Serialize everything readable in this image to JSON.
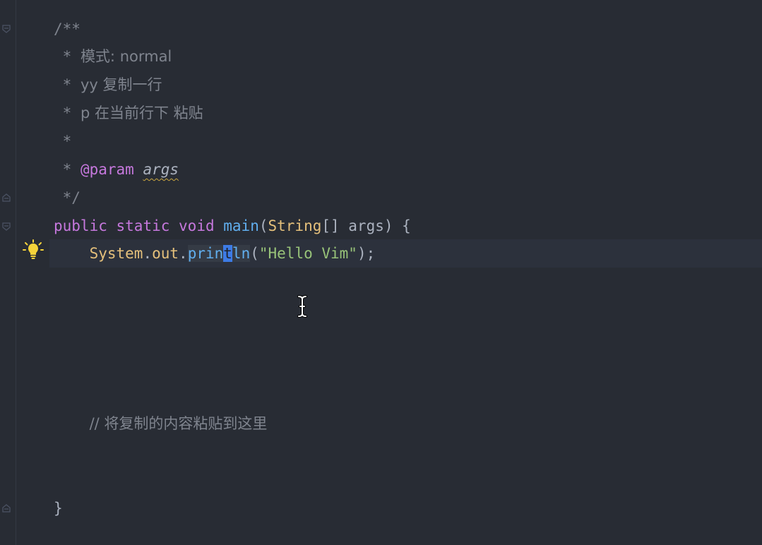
{
  "editor": {
    "lines": {
      "l1": "/**",
      "l2_star": " * ",
      "l2_text": "模式: normal",
      "l3_star": " * ",
      "l3_text": "yy 复制一行",
      "l4_star": " * ",
      "l4_text": "p 在当前行下 粘贴",
      "l5": " *",
      "l6_star": " * ",
      "l6_tag": "@param",
      "l6_param": "args",
      "l7": " */",
      "l8_kw1": "public",
      "l8_kw2": "static",
      "l8_kw3": "void",
      "l8_fn": "main",
      "l8_p1": "(",
      "l8_type": "String",
      "l8_p2": "[] args) {",
      "l9_indent": "    ",
      "l9_class": "System",
      "l9_dot1": ".",
      "l9_field": "out",
      "l9_dot2": ".",
      "l9_fn_a": "prin",
      "l9_fn_cursor": "t",
      "l9_fn_b": "ln",
      "l9_p1": "(",
      "l9_str": "\"Hello Vim\"",
      "l9_p2": ");",
      "l15_indent": "    ",
      "l15_comment": "// 将复制的内容粘贴到这里",
      "l18": "}"
    }
  },
  "colors": {
    "background": "#282c34",
    "keyword": "#c678dd",
    "function": "#61afef",
    "type": "#e5c07b",
    "string": "#98c379",
    "comment": "#7f848e",
    "cursor": "#3d7be5",
    "bulb": "#f5d33a"
  },
  "icons": {
    "bulb": "lightbulb-icon",
    "fold": "fold-marker-icon",
    "mouse": "text-cursor-icon"
  }
}
